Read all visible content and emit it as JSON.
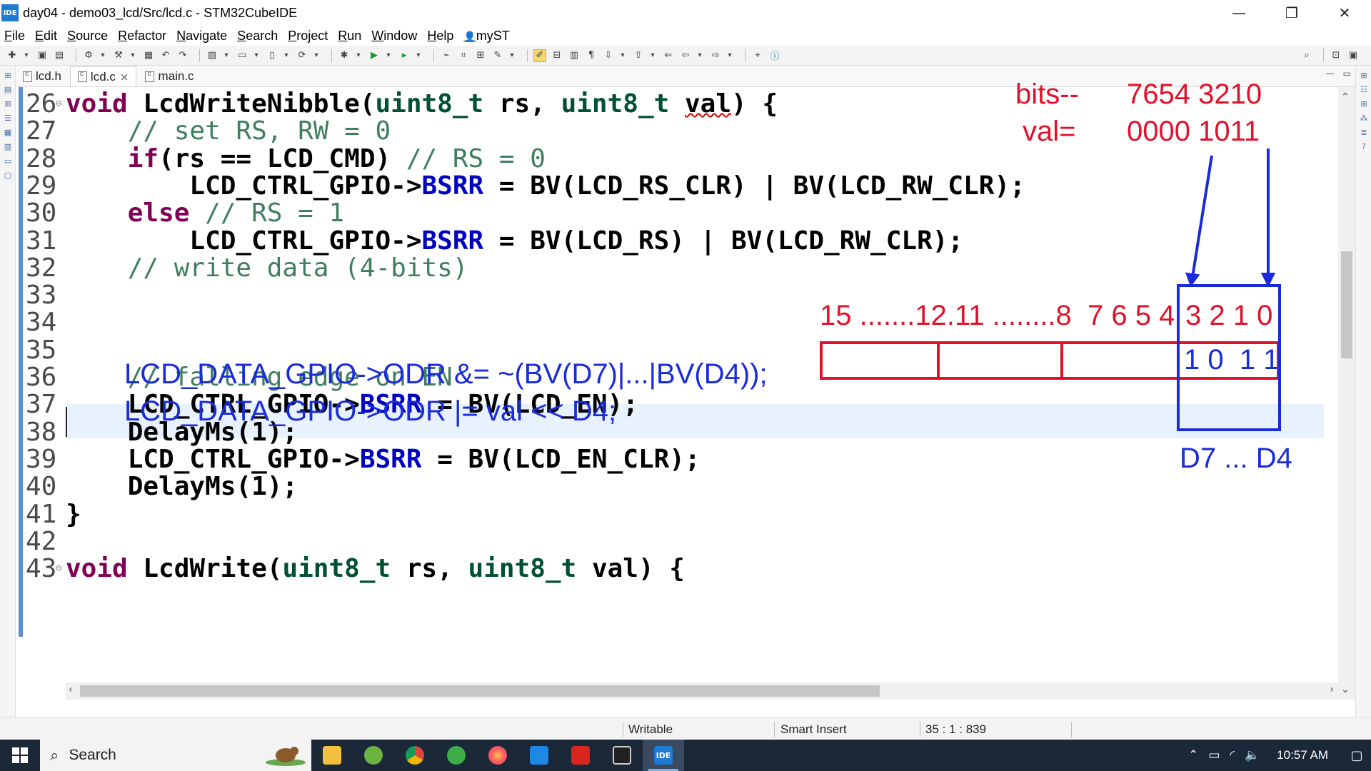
{
  "window": {
    "logo": "IDE",
    "title": "day04 - demo03_lcd/Src/lcd.c - STM32CubeIDE",
    "minimize": "—",
    "maximize": "❐",
    "close": "✕"
  },
  "menu": [
    "File",
    "Edit",
    "Source",
    "Refactor",
    "Navigate",
    "Search",
    "Project",
    "Run",
    "Window",
    "Help",
    "myST"
  ],
  "tabs": [
    {
      "label": "lcd.h",
      "active": false
    },
    {
      "label": "lcd.c",
      "active": true,
      "close": "×"
    },
    {
      "label": "main.c",
      "active": false
    }
  ],
  "code_lines": [
    {
      "n": "26",
      "fold": "⊖",
      "segs": [
        [
          "kw",
          "void "
        ],
        [
          "tx",
          "LcdWriteNibble("
        ],
        [
          "ty",
          "uint8_t"
        ],
        [
          "tx",
          " rs, "
        ],
        [
          "ty",
          "uint8_t"
        ],
        [
          "tx",
          " "
        ],
        [
          "squig",
          "val"
        ],
        [
          "tx",
          ") {"
        ]
      ]
    },
    {
      "n": "27",
      "segs": [
        [
          "cm",
          "    // set RS, RW = 0"
        ]
      ]
    },
    {
      "n": "28",
      "segs": [
        [
          "tx",
          "    "
        ],
        [
          "kw",
          "if"
        ],
        [
          "tx",
          "(rs == LCD_CMD) "
        ],
        [
          "cm",
          "// RS = 0"
        ]
      ]
    },
    {
      "n": "29",
      "segs": [
        [
          "tx",
          "        LCD_CTRL_GPIO->"
        ],
        [
          "fld",
          "BSRR"
        ],
        [
          "tx",
          " = BV(LCD_RS_CLR) | BV(LCD_RW_CLR);"
        ]
      ]
    },
    {
      "n": "30",
      "segs": [
        [
          "tx",
          "    "
        ],
        [
          "kw",
          "else"
        ],
        [
          "tx",
          " "
        ],
        [
          "cm",
          "// RS = 1"
        ]
      ]
    },
    {
      "n": "31",
      "segs": [
        [
          "tx",
          "        LCD_CTRL_GPIO->"
        ],
        [
          "fld",
          "BSRR"
        ],
        [
          "tx",
          " = BV(LCD_RS) | BV(LCD_RW_CLR);"
        ]
      ]
    },
    {
      "n": "32",
      "segs": [
        [
          "cm",
          "    // write data (4-bits)"
        ]
      ]
    },
    {
      "n": "33",
      "segs": []
    },
    {
      "n": "34",
      "segs": []
    },
    {
      "n": "35",
      "segs": []
    },
    {
      "n": "36",
      "segs": [
        [
          "cm",
          "    // falling edge on EN"
        ]
      ]
    },
    {
      "n": "37",
      "segs": [
        [
          "tx",
          "    LCD_CTRL_GPIO->"
        ],
        [
          "fld",
          "BSRR"
        ],
        [
          "tx",
          " = BV(LCD_EN);"
        ]
      ]
    },
    {
      "n": "38",
      "segs": [
        [
          "tx",
          "    DelayMs(1);"
        ]
      ]
    },
    {
      "n": "39",
      "segs": [
        [
          "tx",
          "    LCD_CTRL_GPIO->"
        ],
        [
          "fld",
          "BSRR"
        ],
        [
          "tx",
          " = BV(LCD_EN_CLR);"
        ]
      ]
    },
    {
      "n": "40",
      "segs": [
        [
          "tx",
          "    DelayMs(1);"
        ]
      ]
    },
    {
      "n": "41",
      "segs": [
        [
          "tx",
          "}"
        ]
      ]
    },
    {
      "n": "42",
      "segs": []
    },
    {
      "n": "43",
      "fold": "⊖",
      "segs": [
        [
          "kw",
          "void "
        ],
        [
          "tx",
          "LcdWrite("
        ],
        [
          "ty",
          "uint8_t"
        ],
        [
          "tx",
          " rs, "
        ],
        [
          "ty",
          "uint8_t"
        ],
        [
          "tx",
          " val) {"
        ]
      ]
    }
  ],
  "handwritten": {
    "line1": "LCD_DATA_GPIO->ODR &= ~(BV(D7)|...|BV(D4));",
    "line2": "LCD_DATA_GPIO->ODR |= val << D4;"
  },
  "annotation": {
    "bits_label": "bits--",
    "bits_value": "7654 3210",
    "val_label": "val=",
    "val_value": "0000 1011",
    "reg_bits": "15 .......12.11 ........8  7 6 5 4",
    "reg_bits_low": "3 2 1 0",
    "reg_value": "1 0  1 1",
    "pins": "D7 ... D4",
    "red_color": "#e0122b",
    "blue_color": "#1a2bdb"
  },
  "status": {
    "writable": "Writable",
    "insert_mode": "Smart Insert",
    "position": "35 : 1 : 839"
  },
  "taskbar": {
    "search_placeholder": "Search",
    "clock": "10:57 AM",
    "apps": [
      "file-explorer",
      "spring-tools",
      "chrome",
      "green-app",
      "firefox",
      "vscode",
      "acrobat",
      "terminal",
      "stm32cubeide"
    ]
  }
}
